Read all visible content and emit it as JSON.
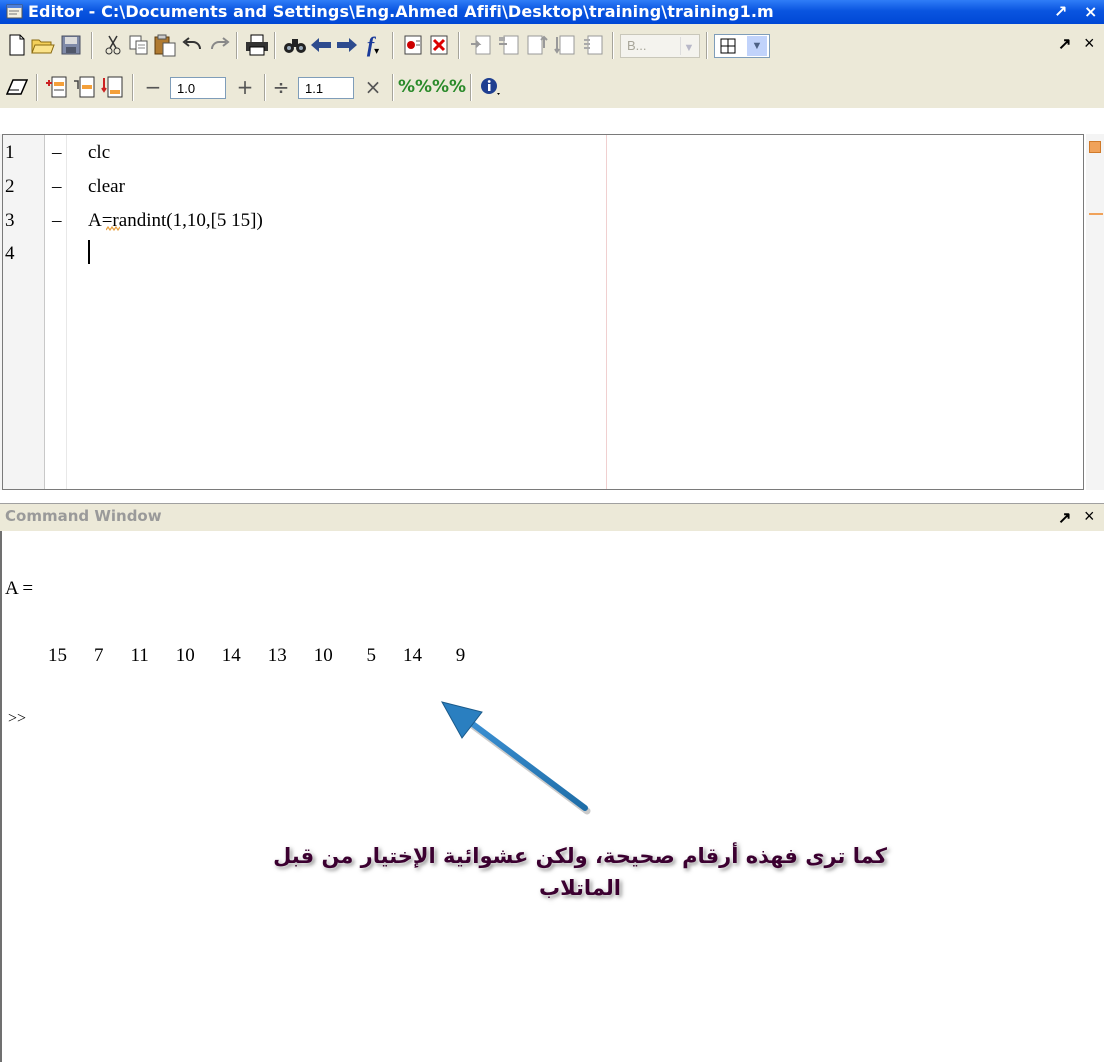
{
  "window": {
    "title": "Editor - C:\\Documents and Settings\\Eng.Ahmed Afifi\\Desktop\\training\\training1.m",
    "undock_glyph": "↗",
    "close_glyph": "×"
  },
  "toolbar1": {
    "icons": [
      "new-file-icon",
      "open-folder-icon",
      "save-icon",
      "cut-icon",
      "copy-icon",
      "paste-icon",
      "undo-icon",
      "redo-icon",
      "print-icon",
      "find-icon",
      "back-arrow-icon",
      "forward-arrow-icon",
      "function-icon",
      "set-breakpoint-icon",
      "clear-breakpoints-icon",
      "step-icon",
      "step-in-icon",
      "step-out-icon",
      "continue-icon",
      "exit-debug-icon"
    ],
    "stack_select_value": "B...",
    "layout_icon": "grid-icon"
  },
  "toolbar2": {
    "minus_label": "−",
    "spacing_value": "1.0",
    "plus_label": "+",
    "divide_label": "÷",
    "scale_value": "1.1",
    "times_label": "×"
  },
  "editor": {
    "lines": [
      {
        "num": "1",
        "marker": "–",
        "code": "clc"
      },
      {
        "num": "2",
        "marker": "–",
        "code": "clear"
      },
      {
        "num": "3",
        "marker": "–",
        "code": "A=randint(1,10,[5 15])"
      },
      {
        "num": "4",
        "marker": "",
        "code": ""
      }
    ],
    "accent_colors": {
      "orange": "#f0a25a"
    }
  },
  "command_window": {
    "title": "Command Window",
    "output_var": "A =",
    "output_values": "15    7    11    10    14    13    10     5    14     9",
    "prompt": ">>"
  },
  "annotation": {
    "line1": "كما ترى فهذه أرقام صحيحة، ولكن عشوائية الإختيار من قبل",
    "line2": "الماتلاب",
    "arrow_color": "#2a7fc0"
  }
}
